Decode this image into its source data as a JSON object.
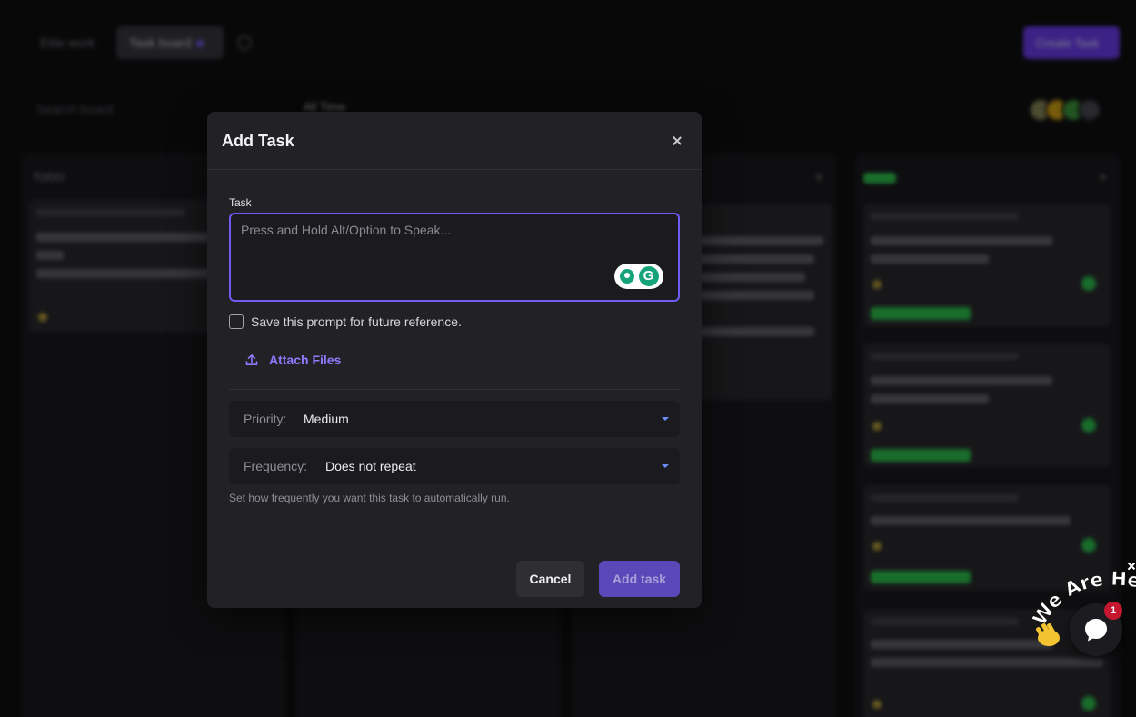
{
  "background": {
    "tabs": [
      {
        "label": "Elite work"
      },
      {
        "label": "Task board"
      }
    ],
    "create_button": "Create Task",
    "search_placeholder": "Search board",
    "filter_label": "All Time",
    "columns": [
      {
        "header": "TODO"
      },
      {
        "header": ""
      },
      {
        "header": ""
      },
      {
        "header": "DONE"
      }
    ]
  },
  "modal": {
    "title": "Add Task",
    "task_label": "Task",
    "task_placeholder": "Press and Hold Alt/Option to Speak...",
    "task_value": "",
    "save_prompt_label": "Save this prompt for future reference.",
    "save_prompt_checked": false,
    "attach_label": "Attach Files",
    "priority": {
      "label": "Priority:",
      "value": "Medium"
    },
    "frequency": {
      "label": "Frequency:",
      "value": "Does not repeat"
    },
    "frequency_help": "Set how frequently you want this task to automatically run.",
    "cancel_label": "Cancel",
    "add_label": "Add task"
  },
  "chat_widget": {
    "banner_text": "We Are Here!",
    "notification_count": "1"
  },
  "colors": {
    "accent": "#6f5cf0",
    "primary_button": "#6f3ff5",
    "link": "#8e7bff",
    "done_green": "#2fc74f",
    "notification_red": "#c5172f"
  }
}
